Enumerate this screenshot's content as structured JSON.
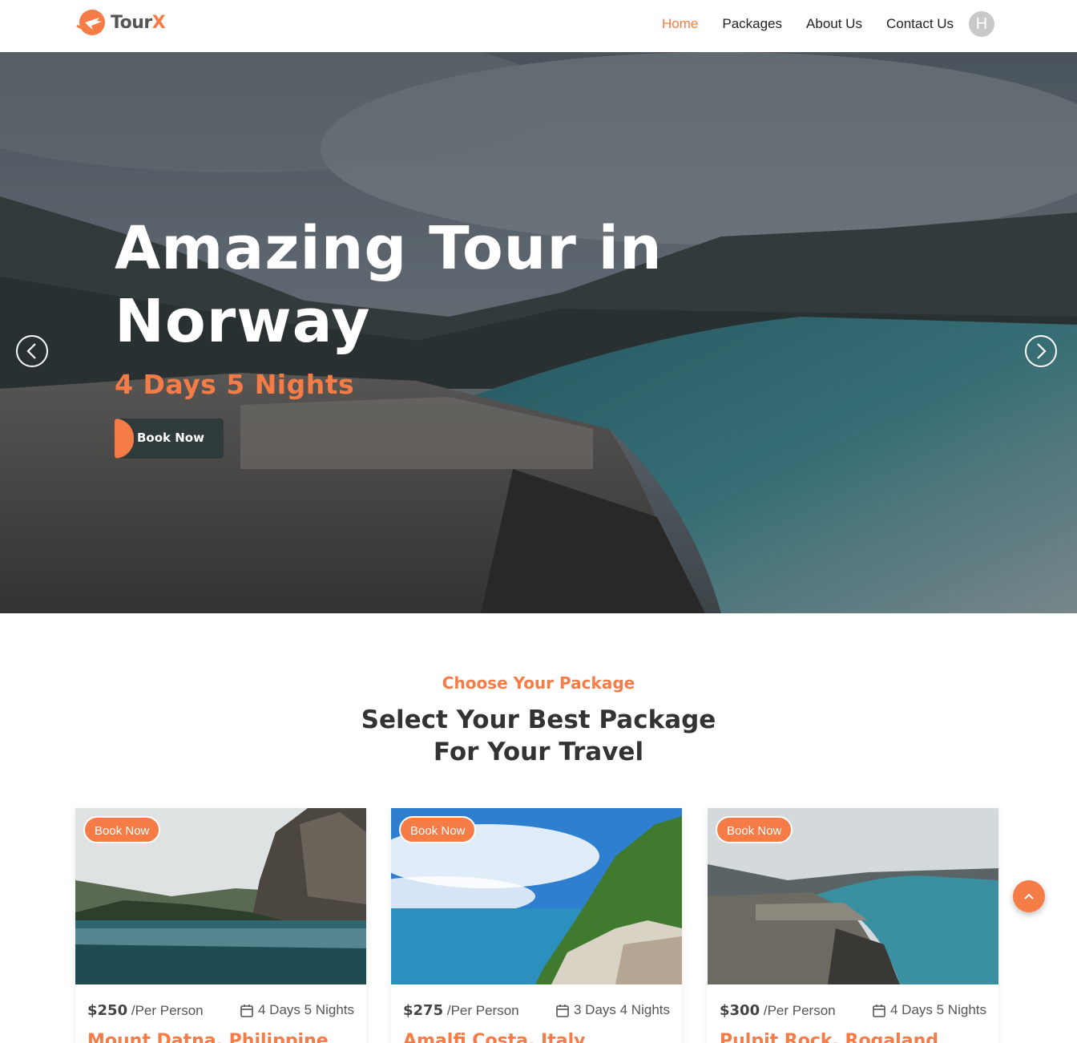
{
  "brand": {
    "name_main": "Tour",
    "name_accent": "X",
    "accent": "#f57c46"
  },
  "nav": {
    "items": [
      {
        "label": "Home",
        "active": true
      },
      {
        "label": "Packages"
      },
      {
        "label": "About Us"
      },
      {
        "label": "Contact Us"
      }
    ],
    "avatar_initial": "H"
  },
  "hero": {
    "title": "Amazing Tour in Norway",
    "subtitle": "4 Days 5 Nights",
    "button_label": "Book Now",
    "prev_icon": "chevron-left-icon",
    "next_icon": "chevron-right-icon"
  },
  "packages_section": {
    "kicker": "Choose Your Package",
    "title_line1": "Select Your Best Package",
    "title_line2": "For Your Travel"
  },
  "packages": [
    {
      "tag": "Book Now",
      "price": "$250",
      "per": "/Per Person",
      "duration": "4 Days 5 Nights",
      "name": "Mount Datna, Philippine"
    },
    {
      "tag": "Book Now",
      "price": "$275",
      "per": "/Per Person",
      "duration": "3 Days 4 Nights",
      "name": "Amalfi Costa, Italy"
    },
    {
      "tag": "Book Now",
      "price": "$300",
      "per": "/Per Person",
      "duration": "4 Days 5 Nights",
      "name": "Pulpit Rock, Rogaland"
    }
  ],
  "scroll_top_icon": "chevron-up-icon"
}
